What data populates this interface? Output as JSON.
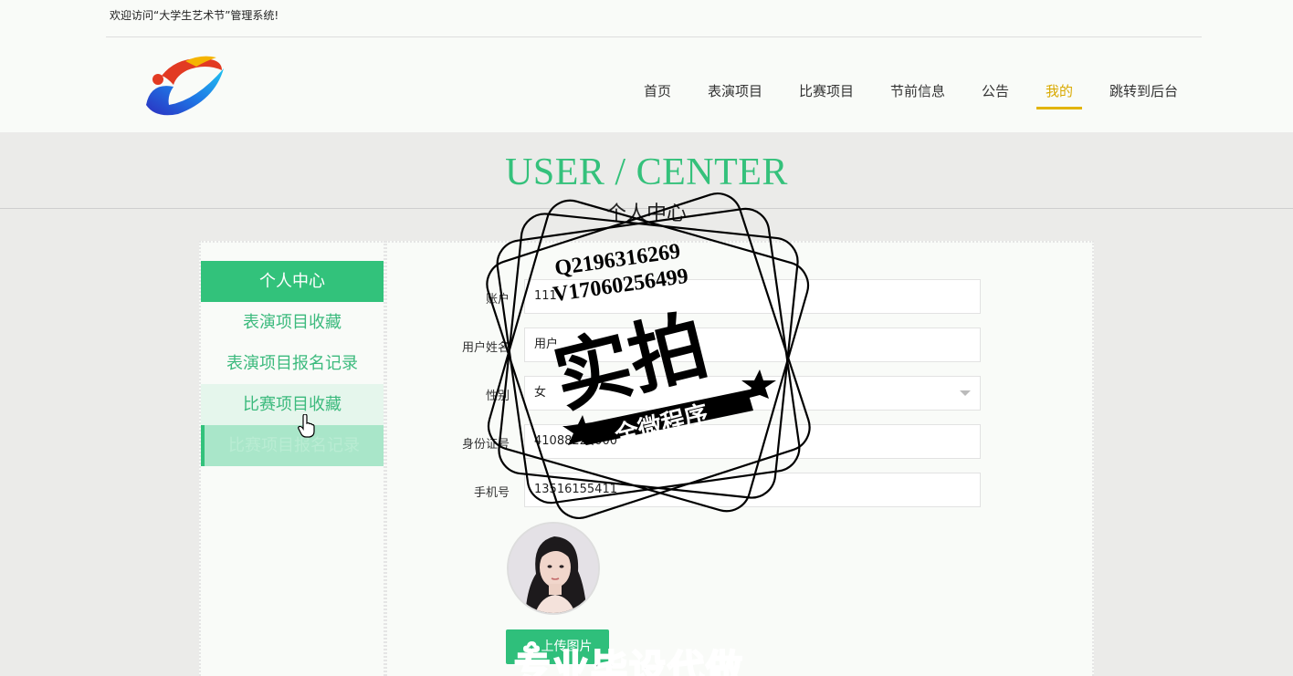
{
  "header": {
    "welcome": "欢迎访问“大学生艺术节”管理系统!",
    "nav": [
      {
        "label": "首页",
        "active": false
      },
      {
        "label": "表演项目",
        "active": false
      },
      {
        "label": "比赛项目",
        "active": false
      },
      {
        "label": "节前信息",
        "active": false
      },
      {
        "label": "公告",
        "active": false
      },
      {
        "label": "我的",
        "active": true
      },
      {
        "label": "跳转到后台",
        "active": false
      }
    ]
  },
  "page": {
    "title": "USER / CENTER",
    "subtitle": "个人中心"
  },
  "sidebar": {
    "items": [
      {
        "label": "个人中心",
        "state": "header"
      },
      {
        "label": "表演项目收藏",
        "state": "normal"
      },
      {
        "label": "表演项目报名记录",
        "state": "normal"
      },
      {
        "label": "比赛项目收藏",
        "state": "hover"
      },
      {
        "label": "比赛项目报名记录",
        "state": "pressed"
      }
    ]
  },
  "form": {
    "fields": [
      {
        "label": "账户",
        "value": "111"
      },
      {
        "label": "用户姓名",
        "value": "用户"
      },
      {
        "label": "性别",
        "value": "女"
      },
      {
        "label": "身份证号",
        "value": "41088220000"
      },
      {
        "label": "手机号",
        "value": "13516155411"
      }
    ],
    "upload_label": "上传图片"
  },
  "watermark": {
    "line1": "Q2196316269",
    "line2": "V17060256499",
    "big": "实拍",
    "banner": "全微程序",
    "bottom": "专业毕设代做"
  },
  "colors": {
    "accent": "#32c27b",
    "nav_active": "#e2b400",
    "title": "#34c17b"
  }
}
